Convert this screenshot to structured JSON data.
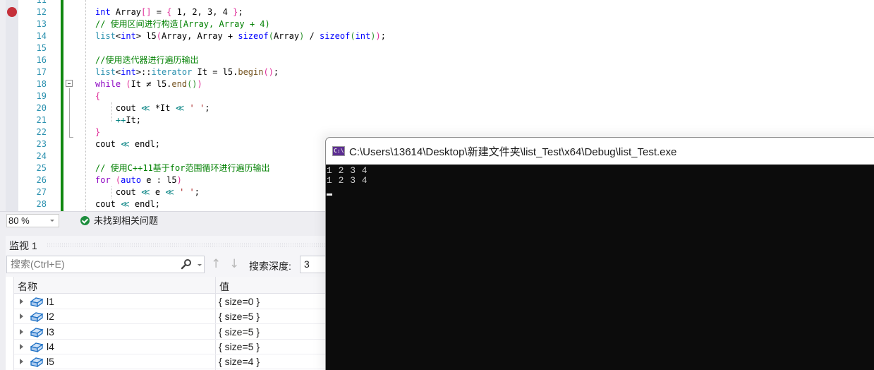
{
  "editor": {
    "line_numbers": [
      "11",
      "12",
      "13",
      "14",
      "15",
      "16",
      "17",
      "18",
      "19",
      "20",
      "21",
      "22",
      "23",
      "24",
      "25",
      "26",
      "27",
      "28"
    ],
    "breakpoint_line": "12",
    "lines": [
      {
        "no": "12",
        "tokens": [
          {
            "t": "int",
            "c": "kw"
          },
          {
            "t": " Array",
            "c": ""
          },
          {
            "t": "[]",
            "c": "br"
          },
          {
            "t": " = ",
            "c": ""
          },
          {
            "t": "{",
            "c": "br"
          },
          {
            "t": " 1, 2, 3, 4 ",
            "c": ""
          },
          {
            "t": "}",
            "c": "br"
          },
          {
            "t": ";",
            "c": ""
          }
        ]
      },
      {
        "no": "13",
        "tokens": [
          {
            "t": "// 使用区间进行构造[Array, Array + 4)",
            "c": "cm"
          }
        ]
      },
      {
        "no": "14",
        "tokens": [
          {
            "t": "list",
            "c": "ty"
          },
          {
            "t": "<",
            "c": ""
          },
          {
            "t": "int",
            "c": "kw"
          },
          {
            "t": "> l5",
            "c": ""
          },
          {
            "t": "(",
            "c": "br"
          },
          {
            "t": "Array, Array + ",
            "c": ""
          },
          {
            "t": "sizeof",
            "c": "kw"
          },
          {
            "t": "(",
            "c": "br2"
          },
          {
            "t": "Array",
            "c": ""
          },
          {
            "t": ")",
            "c": "br2"
          },
          {
            "t": " / ",
            "c": ""
          },
          {
            "t": "sizeof",
            "c": "kw"
          },
          {
            "t": "(",
            "c": "br2"
          },
          {
            "t": "int",
            "c": "kw"
          },
          {
            "t": ")",
            "c": "br2"
          },
          {
            "t": ")",
            "c": "br"
          },
          {
            "t": ";",
            "c": ""
          }
        ]
      },
      {
        "no": "15",
        "tokens": []
      },
      {
        "no": "16",
        "tokens": [
          {
            "t": "//使用迭代器进行遍历输出",
            "c": "cm"
          }
        ]
      },
      {
        "no": "17",
        "tokens": [
          {
            "t": "list",
            "c": "ty"
          },
          {
            "t": "<",
            "c": ""
          },
          {
            "t": "int",
            "c": "kw"
          },
          {
            "t": ">::",
            "c": ""
          },
          {
            "t": "iterator",
            "c": "ty"
          },
          {
            "t": " It = l5.",
            "c": ""
          },
          {
            "t": "begin",
            "c": "fn"
          },
          {
            "t": "()",
            "c": "br"
          },
          {
            "t": ";",
            "c": ""
          }
        ]
      },
      {
        "no": "18",
        "tokens": [
          {
            "t": "while",
            "c": "kw2"
          },
          {
            "t": " ",
            "c": ""
          },
          {
            "t": "(",
            "c": "br"
          },
          {
            "t": "It ≠ l5.",
            "c": ""
          },
          {
            "t": "end",
            "c": "fn"
          },
          {
            "t": "()",
            "c": "br2"
          },
          {
            "t": ")",
            "c": "br"
          }
        ]
      },
      {
        "no": "19",
        "tokens": [
          {
            "t": "{",
            "c": "br"
          }
        ]
      },
      {
        "no": "20",
        "tokens": [
          {
            "t": "    cout ",
            "c": ""
          },
          {
            "t": "≪",
            "c": "op"
          },
          {
            "t": " *It ",
            "c": ""
          },
          {
            "t": "≪",
            "c": "op"
          },
          {
            "t": " ",
            "c": ""
          },
          {
            "t": "' '",
            "c": "st"
          },
          {
            "t": ";",
            "c": ""
          }
        ]
      },
      {
        "no": "21",
        "tokens": [
          {
            "t": "    ",
            "c": ""
          },
          {
            "t": "++",
            "c": "op"
          },
          {
            "t": "It;",
            "c": ""
          }
        ]
      },
      {
        "no": "22",
        "tokens": [
          {
            "t": "}",
            "c": "br"
          }
        ]
      },
      {
        "no": "23",
        "tokens": [
          {
            "t": "cout ",
            "c": ""
          },
          {
            "t": "≪",
            "c": "op"
          },
          {
            "t": " endl;",
            "c": ""
          }
        ]
      },
      {
        "no": "24",
        "tokens": []
      },
      {
        "no": "25",
        "tokens": [
          {
            "t": "// 使用C++11基于for范围循环进行遍历输出",
            "c": "cm"
          }
        ]
      },
      {
        "no": "26",
        "tokens": [
          {
            "t": "for",
            "c": "kw2"
          },
          {
            "t": " ",
            "c": ""
          },
          {
            "t": "(",
            "c": "br"
          },
          {
            "t": "auto",
            "c": "kw"
          },
          {
            "t": " e : l5",
            "c": ""
          },
          {
            "t": ")",
            "c": "br"
          }
        ]
      },
      {
        "no": "27",
        "tokens": [
          {
            "t": "    cout ",
            "c": ""
          },
          {
            "t": "≪",
            "c": "op"
          },
          {
            "t": " e ",
            "c": ""
          },
          {
            "t": "≪",
            "c": "op"
          },
          {
            "t": " ",
            "c": ""
          },
          {
            "t": "' '",
            "c": "st"
          },
          {
            "t": ";",
            "c": ""
          }
        ]
      },
      {
        "no": "28",
        "tokens": [
          {
            "t": "cout ",
            "c": ""
          },
          {
            "t": "≪",
            "c": "op"
          },
          {
            "t": " endl;",
            "c": ""
          }
        ]
      }
    ]
  },
  "statusbar": {
    "zoom_level": "80 %",
    "issues_text": "未找到相关问题"
  },
  "watch": {
    "title": "监视 1",
    "search_placeholder": "搜索(Ctrl+E)",
    "search_depth_label": "搜索深度:",
    "search_depth_value": "3",
    "columns": {
      "name": "名称",
      "value": "值"
    },
    "rows": [
      {
        "name": "l1",
        "value": "{ size=0 }"
      },
      {
        "name": "l2",
        "value": "{ size=5 }"
      },
      {
        "name": "l3",
        "value": "{ size=5 }"
      },
      {
        "name": "l4",
        "value": "{ size=5 }"
      },
      {
        "name": "l5",
        "value": "{ size=4 }"
      }
    ]
  },
  "console": {
    "icon_text": "C:\\",
    "title": "C:\\Users\\13614\\Desktop\\新建文件夹\\list_Test\\x64\\Debug\\list_Test.exe",
    "output_lines": [
      "1 2 3 4",
      "1 2 3 4"
    ]
  },
  "colors": {
    "breakpoint": "#c5303a",
    "change_bar": "#108810",
    "line_number": "#2b91af",
    "console_bg": "#0c0c0c"
  }
}
